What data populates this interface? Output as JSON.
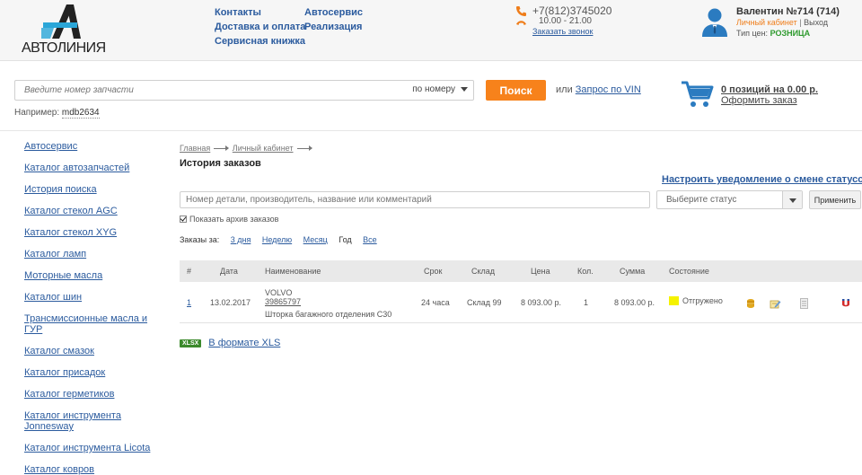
{
  "header": {
    "logo_text": "АВТОЛИНИЯ",
    "nav_col1": [
      "Контакты",
      "Доставка и оплата",
      "Сервисная книжка"
    ],
    "nav_col2": [
      "Автосервис",
      "Реализация"
    ],
    "phone": "+7(812)3745020",
    "hours": "10.00 - 21.00",
    "callback": "Заказать звонок",
    "user": {
      "name": "Валентин №714 (714)",
      "cabinet": "Личный кабинет",
      "separator": "|",
      "logout": "Выход",
      "price_type_label": "Тип цен:",
      "price_type": "РОЗНИЦА"
    }
  },
  "search": {
    "placeholder": "Введите номер запчасти",
    "mode": "по номеру",
    "button": "Поиск",
    "vin_prefix": "или",
    "vin_link": "Запрос по VIN",
    "example_label": "Например:",
    "example_value": "mdb2634"
  },
  "cart": {
    "count": "0 позиций на 0.00 р.",
    "checkout": "Оформить заказ"
  },
  "sidebar": {
    "items": [
      "Автосервис",
      "Каталог автозапчастей",
      "История поиска",
      "Каталог стекол AGC",
      "Каталог стекол XYG",
      "Каталог ламп",
      "Моторные масла",
      "Каталог шин",
      "Трансмиссионные масла и ГУР",
      "Каталог смазок",
      "Каталог присадок",
      "Каталог герметиков",
      "Каталог инструмента Jonnesway",
      "Каталог инструмента Licota",
      "Каталог ковров"
    ]
  },
  "main": {
    "breadcrumb": [
      "Главная",
      "Личный кабинет"
    ],
    "title": "История заказов",
    "notify_link": "Настроить уведомление о смене статусов",
    "filter_placeholder": "Номер детали, производитель, название или комментарий",
    "status_select": "Выберите статус",
    "apply_button": "Применить",
    "archive_label": "Показать архив заказов",
    "archive_checked": true,
    "periods_label": "Заказы за:",
    "periods": [
      "3 дня",
      "Неделю",
      "Месяц",
      "Год",
      "Все"
    ],
    "table": {
      "headers": [
        "#",
        "Дата",
        "Наименование",
        "Срок",
        "Склад",
        "Цена",
        "Кол.",
        "Сумма",
        "Состояние"
      ],
      "rows": [
        {
          "num": "1",
          "date": "13.02.2017",
          "brand": "VOLVO",
          "part_number": "39865797",
          "part_name": "Шторка багажного отделения С30",
          "term": "24 часа",
          "warehouse": "Склад 99",
          "price": "8 093.00 р.",
          "qty": "1",
          "sum": "8 093.00 р.",
          "status": "Отгружено",
          "status_color": "#f5f200"
        }
      ]
    },
    "xls_badge": "XLSX",
    "xls_link": "В формате XLS"
  }
}
